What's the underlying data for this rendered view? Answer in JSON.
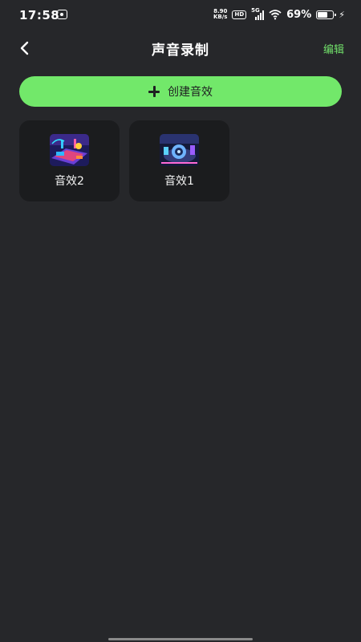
{
  "status_bar": {
    "time": "17:58",
    "net_speed_value": "8.90",
    "net_speed_unit": "KB/s",
    "hd_label": "HD",
    "network_label": "5G",
    "battery_text": "69%",
    "battery_level": 0.69
  },
  "header": {
    "title": "声音录制",
    "edit_label": "编辑"
  },
  "create_button": {
    "label": "创建音效"
  },
  "effects": [
    {
      "label": "音效2"
    },
    {
      "label": "音效1"
    }
  ],
  "colors": {
    "accent": "#72e86a",
    "background": "#26272a",
    "card": "#1b1c1e"
  }
}
